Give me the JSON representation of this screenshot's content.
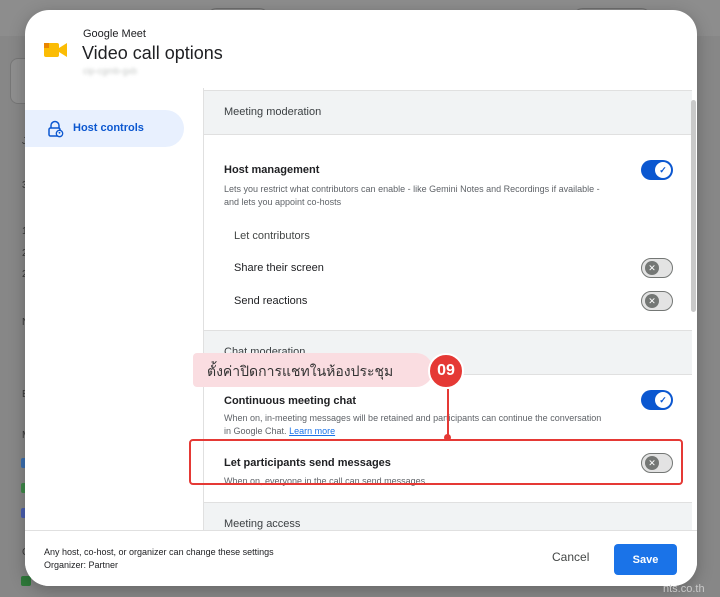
{
  "dialog": {
    "app_name": "Google Meet",
    "title": "Video call options",
    "account": "cip-cgmb-gxb"
  },
  "sidebar": {
    "items": [
      {
        "label": "Host controls",
        "icon": "lock-person-icon",
        "selected": true
      }
    ]
  },
  "sections": {
    "meeting_moderation": {
      "title": "Meeting moderation",
      "host_management": {
        "title": "Host management",
        "description": "Lets you restrict what contributors can enable - like Gemini Notes and Recordings if available - and lets you appoint co-hosts",
        "enabled": true
      },
      "let_contributors": "Let contributors",
      "share_screen": {
        "title": "Share their screen",
        "enabled": false
      },
      "send_reactions": {
        "title": "Send reactions",
        "enabled": false
      }
    },
    "chat_moderation": {
      "title": "Chat moderation",
      "continuous_chat": {
        "title": "Continuous meeting chat",
        "description": "When on, in-meeting messages will be retained and participants can continue the conversation in Google Chat.",
        "link": "Learn more",
        "enabled": true
      },
      "send_messages": {
        "title": "Let participants send messages",
        "description": "When on, everyone in the call can send messages",
        "enabled": false
      }
    },
    "meeting_access": {
      "title": "Meeting access"
    }
  },
  "footer": {
    "line1": "Any host, co-host, or organizer can change these settings",
    "line2": "Organizer: Partner",
    "cancel": "Cancel",
    "save": "Save"
  },
  "annotation": {
    "callout": "ตั้งค่าปิดการแชทในห้องประชุม",
    "step": "09"
  },
  "watermark": "nts.co.th",
  "colors": {
    "accent": "#0b57d0",
    "save_button": "#1a73e8",
    "annotation_red": "#e53935",
    "callout_bg": "#fadde1"
  }
}
